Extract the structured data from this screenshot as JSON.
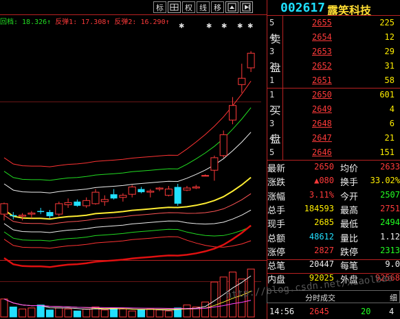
{
  "header": {
    "toolbar_buttons": [
      {
        "label": "标",
        "icon": ""
      },
      {
        "label": "",
        "icon": "grid-icon"
      },
      {
        "label": "权",
        "icon": ""
      },
      {
        "label": "线",
        "icon": ""
      },
      {
        "label": "移",
        "icon": ""
      },
      {
        "label": "",
        "icon": "chart-up-icon"
      },
      {
        "label": "",
        "icon": "play-icon"
      }
    ],
    "stock_code": "002617",
    "stock_name": "露笑科技"
  },
  "ma_legend": [
    {
      "label": "回档: ",
      "value": "18.326↑",
      "color": "#22dd22"
    },
    {
      "label": "反弹1: ",
      "value": "17.308↑",
      "color": "#ff3a3a"
    },
    {
      "label": "反弹2: ",
      "value": "16.290↑",
      "color": "#ff3a3a"
    }
  ],
  "chart_data": {
    "type": "candlestick",
    "candles": [
      {
        "o": 14.4,
        "h": 14.95,
        "l": 14.1,
        "c": 14.9
      },
      {
        "o": 14.35,
        "h": 14.5,
        "l": 14.15,
        "c": 14.3
      },
      {
        "o": 14.3,
        "h": 14.45,
        "l": 14.1,
        "c": 14.35
      },
      {
        "o": 14.4,
        "h": 14.55,
        "l": 14.2,
        "c": 14.45
      },
      {
        "o": 14.55,
        "h": 14.7,
        "l": 14.4,
        "c": 14.5
      },
      {
        "o": 14.5,
        "h": 14.6,
        "l": 14.2,
        "c": 14.3
      },
      {
        "o": 14.4,
        "h": 15.0,
        "l": 14.3,
        "c": 14.9
      },
      {
        "o": 14.85,
        "h": 15.15,
        "l": 14.7,
        "c": 14.95
      },
      {
        "o": 15.0,
        "h": 15.1,
        "l": 14.75,
        "c": 14.8
      },
      {
        "o": 14.8,
        "h": 15.2,
        "l": 14.7,
        "c": 15.05
      },
      {
        "o": 14.9,
        "h": 15.6,
        "l": 14.85,
        "c": 15.45
      },
      {
        "o": 15.0,
        "h": 15.3,
        "l": 14.8,
        "c": 15.1
      },
      {
        "o": 15.35,
        "h": 15.6,
        "l": 15.1,
        "c": 15.15
      },
      {
        "o": 15.2,
        "h": 15.4,
        "l": 15.0,
        "c": 15.3
      },
      {
        "o": 15.35,
        "h": 15.8,
        "l": 15.2,
        "c": 15.7
      },
      {
        "o": 15.6,
        "h": 15.7,
        "l": 15.4,
        "c": 15.45
      },
      {
        "o": 15.45,
        "h": 15.6,
        "l": 15.2,
        "c": 15.5
      },
      {
        "o": 15.6,
        "h": 15.7,
        "l": 15.5,
        "c": 15.65
      },
      {
        "o": 15.3,
        "h": 15.75,
        "l": 15.25,
        "c": 15.6
      },
      {
        "o": 15.7,
        "h": 15.85,
        "l": 14.8,
        "c": 14.9
      },
      {
        "o": 15.55,
        "h": 15.75,
        "l": 15.5,
        "c": 15.65
      },
      {
        "o": 15.65,
        "h": 15.8,
        "l": 15.6,
        "c": 15.7
      },
      {
        "o": 16.25,
        "h": 16.3,
        "l": 16.25,
        "c": 16.25
      },
      {
        "o": 16.5,
        "h": 17.2,
        "l": 16.0,
        "c": 17.1
      },
      {
        "o": 17.2,
        "h": 18.4,
        "l": 17.1,
        "c": 18.2
      },
      {
        "o": 18.9,
        "h": 20.0,
        "l": 18.7,
        "c": 19.6
      },
      {
        "o": 20.6,
        "h": 21.6,
        "l": 20.2,
        "c": 20.9
      },
      {
        "o": 21.4,
        "h": 22.2,
        "l": 21.2,
        "c": 22.1
      }
    ],
    "ylim": [
      12.5,
      23.4
    ],
    "volume": [
      18,
      10,
      8,
      9,
      12,
      7,
      9,
      8,
      6,
      8,
      10,
      7,
      9,
      8,
      6,
      7,
      8,
      7,
      6,
      9,
      12,
      10,
      15,
      35,
      40,
      45,
      38,
      48
    ],
    "volume_ylim": [
      0,
      55
    ]
  },
  "order_book": {
    "sell_label_top": "卖",
    "sell_label_bottom": "盘",
    "buy_label_top": "买",
    "buy_label_bottom": "盘",
    "asks": [
      {
        "level": "5",
        "price": "2655",
        "volume": "225"
      },
      {
        "level": "4",
        "price": "2654",
        "volume": "12"
      },
      {
        "level": "3",
        "price": "2653",
        "volume": "29"
      },
      {
        "level": "2",
        "price": "2652",
        "volume": "31"
      },
      {
        "level": "1",
        "price": "2651",
        "volume": "58"
      }
    ],
    "bids": [
      {
        "level": "1",
        "price": "2650",
        "volume": "601"
      },
      {
        "level": "2",
        "price": "2649",
        "volume": "4"
      },
      {
        "level": "3",
        "price": "2648",
        "volume": "6"
      },
      {
        "level": "4",
        "price": "2647",
        "volume": "21"
      },
      {
        "level": "5",
        "price": "2646",
        "volume": "151"
      }
    ]
  },
  "stats": {
    "latest_label": "最新",
    "latest": "2650",
    "avg_label": "均价",
    "avg": "2633",
    "change_label": "涨跌",
    "change": "▲080",
    "turnover_label": "换手",
    "turnover": "33.02%",
    "pct_label": "涨幅",
    "pct": "3.11%",
    "open_label": "今开",
    "open": "2507",
    "total_vol_label": "总手",
    "total_vol": "184593",
    "high_label": "最高",
    "high": "2751",
    "cur_vol_label": "现手",
    "cur_vol": "2685",
    "low_label": "最低",
    "low": "2494",
    "amount_label": "总额",
    "amount": "48612",
    "vol_ratio_label": "量比",
    "vol_ratio": "1.12",
    "limit_up_label": "涨停",
    "limit_up": "2827",
    "limit_down_label": "跌停",
    "limit_down": "2313",
    "trades_label": "总笔",
    "trades": "20447",
    "per_trade_label": "每笔",
    "per_trade": "9.0",
    "inner_label": "内盘",
    "inner": "92025",
    "outer_label": "外盘",
    "outer": "92568"
  },
  "tabs": {
    "ticks_label": "分时成交",
    "detail_label": "细"
  },
  "tick": {
    "time": "14:56",
    "price": "2645",
    "volume": "20",
    "flag": "4"
  },
  "watermark": "http://blog.csdn.net/xiaolbao"
}
